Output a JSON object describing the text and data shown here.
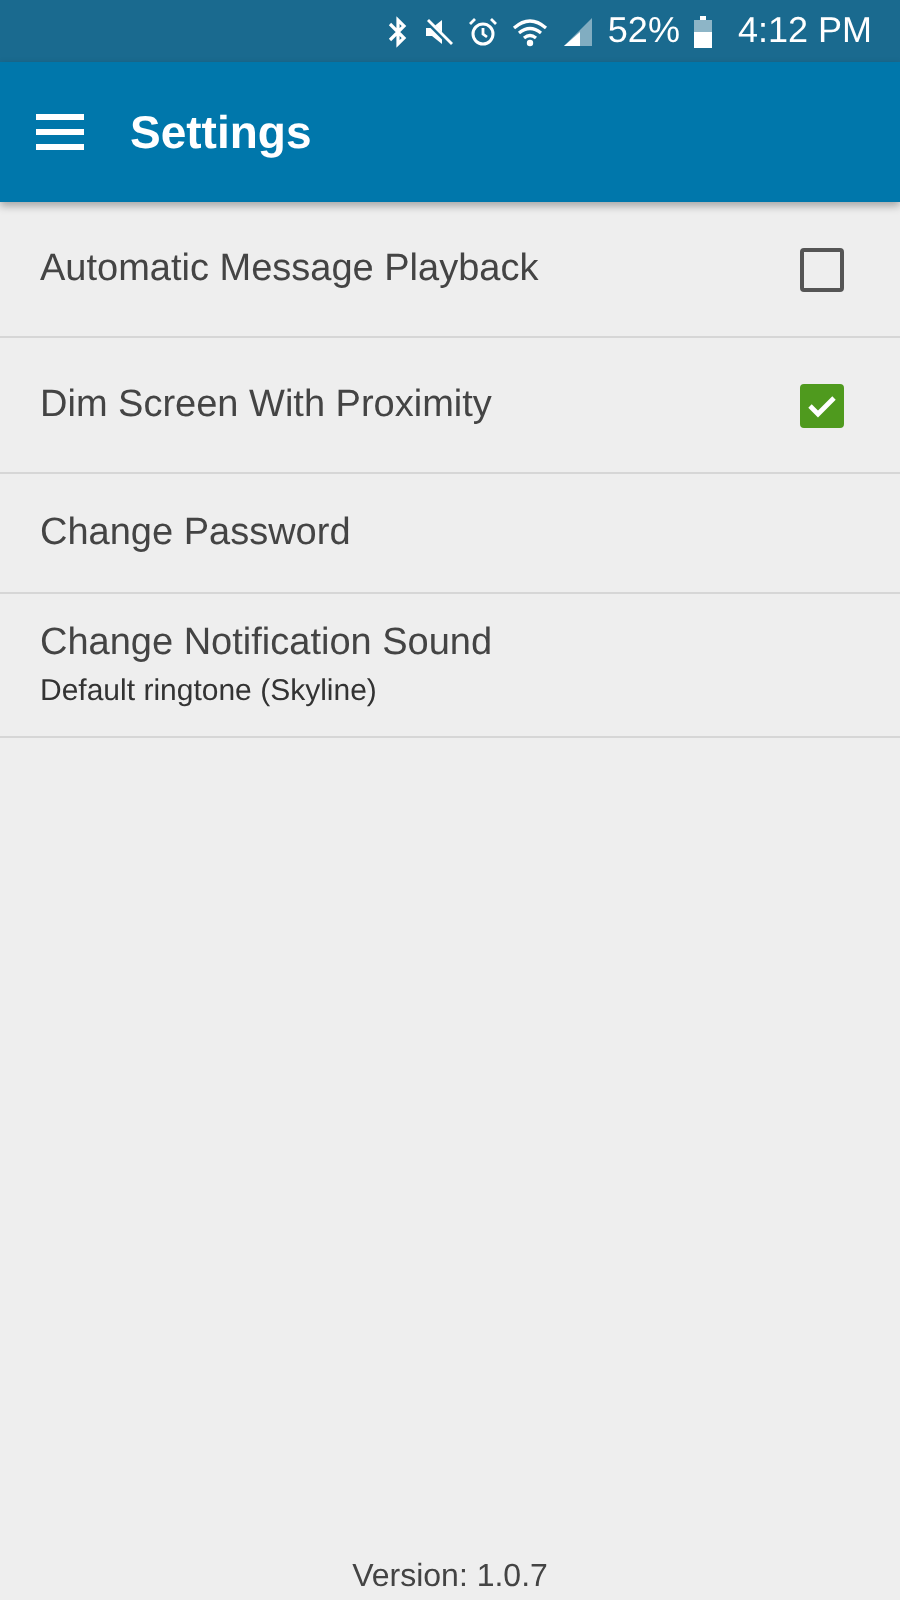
{
  "status_bar": {
    "battery": "52%",
    "time": "4:12 PM"
  },
  "app_bar": {
    "title": "Settings"
  },
  "settings": [
    {
      "kind": "checkbox",
      "label": "Automatic Message Playback",
      "checked": false
    },
    {
      "kind": "checkbox",
      "label": "Dim Screen With Proximity",
      "checked": true
    },
    {
      "kind": "action",
      "label": "Change Password"
    },
    {
      "kind": "action",
      "label": "Change Notification Sound",
      "summary": "Default ringtone (Skyline)"
    }
  ],
  "version": "Version: 1.0.7"
}
